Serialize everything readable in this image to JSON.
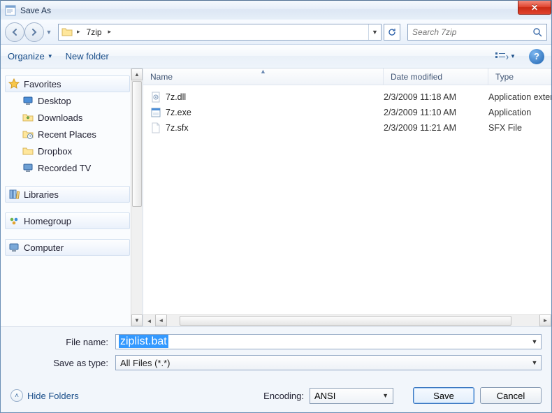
{
  "window": {
    "title": "Save As"
  },
  "address": {
    "folder_icon": "folder",
    "current": "7zip"
  },
  "search": {
    "placeholder": "Search 7zip"
  },
  "toolbar": {
    "organize": "Organize",
    "new_folder": "New folder"
  },
  "navpane": {
    "favorites": {
      "label": "Favorites",
      "items": [
        {
          "icon": "desktop",
          "label": "Desktop"
        },
        {
          "icon": "downloads",
          "label": "Downloads"
        },
        {
          "icon": "recent",
          "label": "Recent Places"
        },
        {
          "icon": "dropbox",
          "label": "Dropbox"
        },
        {
          "icon": "tv",
          "label": "Recorded TV"
        }
      ]
    },
    "libraries": {
      "label": "Libraries"
    },
    "homegroup": {
      "label": "Homegroup"
    },
    "computer": {
      "label": "Computer"
    }
  },
  "columns": {
    "name": "Name",
    "date": "Date modified",
    "type": "Type"
  },
  "files": [
    {
      "icon": "dll",
      "name": "7z.dll",
      "date": "2/3/2009 11:18 AM",
      "type": "Application extension"
    },
    {
      "icon": "exe",
      "name": "7z.exe",
      "date": "2/3/2009 11:10 AM",
      "type": "Application"
    },
    {
      "icon": "file",
      "name": "7z.sfx",
      "date": "2/3/2009 11:21 AM",
      "type": "SFX File"
    }
  ],
  "form": {
    "filename_label": "File name:",
    "filename_value": "ziplist.bat",
    "savetype_label": "Save as type:",
    "savetype_value": "All Files  (*.*)"
  },
  "footer": {
    "hide_folders": "Hide Folders",
    "encoding_label": "Encoding:",
    "encoding_value": "ANSI",
    "save": "Save",
    "cancel": "Cancel"
  }
}
